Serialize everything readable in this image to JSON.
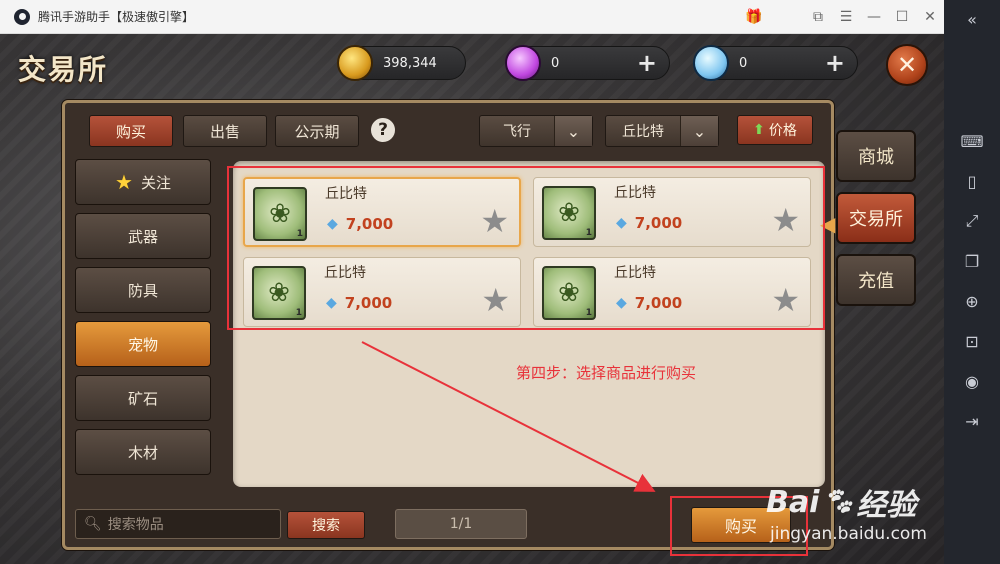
{
  "window": {
    "title": "腾讯手游助手【极速傲引擎】",
    "icons": [
      "gift-icon",
      "fullscreen-icon",
      "menu-icon",
      "minimize-icon",
      "maximize-icon",
      "close-icon",
      "collapse-icon"
    ]
  },
  "sidebar_tools": [
    "keyboard-icon",
    "shake-icon",
    "fullscreen-expand-icon",
    "multi-window-icon",
    "location-icon",
    "screenshot-icon",
    "record-icon",
    "exit-icon"
  ],
  "header": {
    "title": "交易所",
    "gold": "398,344",
    "gems": "0",
    "diamonds": "0"
  },
  "tabs": [
    {
      "label": "购买",
      "active": true
    },
    {
      "label": "出售",
      "active": false
    },
    {
      "label": "公示期",
      "active": false
    }
  ],
  "help_label": "?",
  "filters": {
    "type_dropdown": "飞行",
    "item_dropdown": "丘比特",
    "sort_label": "价格"
  },
  "categories": [
    {
      "label": "关注",
      "icon": "star-icon",
      "active": false
    },
    {
      "label": "武器",
      "active": false
    },
    {
      "label": "防具",
      "active": false
    },
    {
      "label": "宠物",
      "active": true
    },
    {
      "label": "矿石",
      "active": false
    },
    {
      "label": "木材",
      "active": false
    }
  ],
  "items": [
    {
      "name": "丘比特",
      "price": "7,000",
      "level": "1",
      "selected": true
    },
    {
      "name": "丘比特",
      "price": "7,000",
      "level": "1",
      "selected": false
    },
    {
      "name": "丘比特",
      "price": "7,000",
      "level": "1",
      "selected": false
    },
    {
      "name": "丘比特",
      "price": "7,000",
      "level": "1",
      "selected": false
    }
  ],
  "bottom": {
    "search_placeholder": "搜索物品",
    "search_button": "搜索",
    "page_indicator": "1/1",
    "buy_button": "购买"
  },
  "side_tabs": [
    {
      "label": "商城",
      "active": false
    },
    {
      "label": "交易所",
      "active": true
    },
    {
      "label": "充值",
      "active": false
    }
  ],
  "annotation": {
    "step_text": "第四步：选择商品进行购买",
    "color": "#e8323a"
  },
  "watermark": {
    "brand_left": "Bai",
    "brand_right": "经验",
    "url": "jingyan.baidu.com"
  },
  "colors": {
    "accent_orange": "#e59a3c",
    "accent_red": "#b5523a",
    "price_red": "#c2421f"
  }
}
